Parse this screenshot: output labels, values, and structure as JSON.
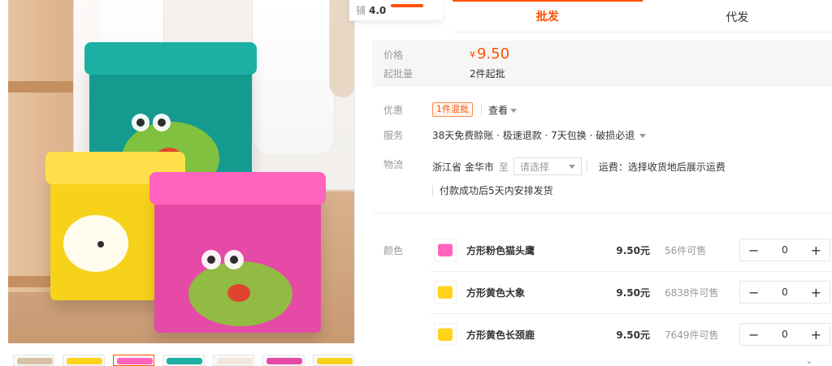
{
  "left_panel": {
    "thumb_count": 8,
    "active_thumb_index": 2
  },
  "right_panel": {
    "rating_prefix": "铺",
    "rating_score": "4.0",
    "tabs": [
      {
        "label": "批发",
        "active": true
      },
      {
        "label": "代发",
        "active": false
      }
    ],
    "price": {
      "label": "价格",
      "currency": "¥",
      "value": "9.50"
    },
    "moq": {
      "label": "起批量",
      "value": "2件起批"
    },
    "coupon": {
      "label": "优惠",
      "badge": "1件混批",
      "link": "查看"
    },
    "service": {
      "label": "服务",
      "text": "38天免费赊账 · 极速退款 · 7天包换 · 破损必退"
    },
    "logistics": {
      "label": "物流",
      "from": "浙江省 金华市",
      "to": "至",
      "select_placeholder": "请选择",
      "shipping_fee": "运费：选择收货地后展示运费",
      "dispatch": "付款成功后5天内安排发货"
    },
    "variants": {
      "label": "颜色",
      "items": [
        {
          "name": "方形粉色猫头鹰",
          "price": "9.50元",
          "stock": "56件可售",
          "qty": "0",
          "thumb_color": "#ff63bd"
        },
        {
          "name": "方形黄色大象",
          "price": "9.50元",
          "stock": "6838件可售",
          "qty": "0",
          "thumb_color": "#ffd31a"
        },
        {
          "name": "方形黄色长颈鹿",
          "price": "9.50元",
          "stock": "7649件可售",
          "qty": "0",
          "thumb_color": "#ffd31a"
        }
      ]
    },
    "controls": {
      "minus": "−",
      "plus": "+",
      "collapse": "⌄"
    }
  }
}
